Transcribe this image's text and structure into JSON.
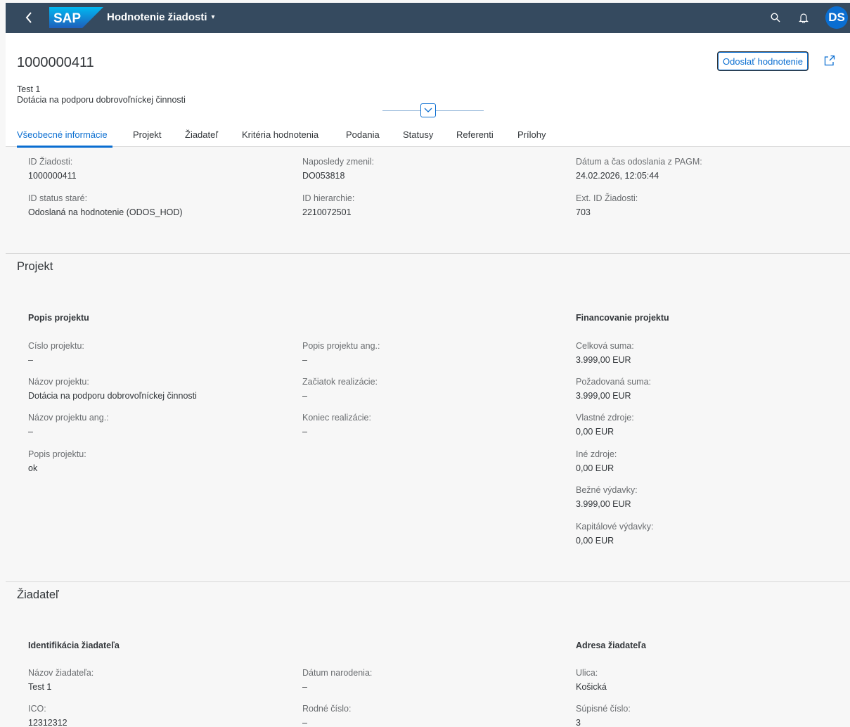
{
  "shell": {
    "title": "Hodnotenie žiadosti",
    "caret": "▾",
    "avatar": "DS",
    "icons": [
      "back-icon",
      "search-icon",
      "bell-icon"
    ]
  },
  "header": {
    "object_id": "1000000411",
    "subtitle1": "Test 1",
    "subtitle2": "Dotácia na podporu dobrovoľníckej činnosti",
    "send_button": "Odoslať hodnotenie"
  },
  "tabs": [
    "Všeobecné informácie",
    "Projekt",
    "Žiadateľ",
    "Kritéria hodnotenia",
    "Podania",
    "Statusy",
    "Referenti",
    "Prílohy"
  ],
  "general": {
    "f1": {
      "label": "ID Žiadosti:",
      "value": "1000000411"
    },
    "f2": {
      "label": "Naposledy zmenil:",
      "value": "DO053818"
    },
    "f3": {
      "label": "Dátum a čas odoslania z PAGM:",
      "value": "24.02.2026, 12:05:44"
    },
    "f4": {
      "label": "ID status staré:",
      "value": "Odoslaná na hodnotenie (ODOS_HOD)"
    },
    "f5": {
      "label": "ID hierarchie:",
      "value": "2210072501"
    },
    "f6": {
      "label": "Ext. ID Žiadosti:",
      "value": "703"
    }
  },
  "projekt": {
    "title": "Projekt",
    "group1": "Popis projektu",
    "group2": "Financovanie projektu",
    "c1": [
      {
        "label": "Císlo projektu:",
        "value": "–"
      },
      {
        "label": "Názov projektu:",
        "value": "Dotácia na podporu dobrovoľníckej činnosti"
      },
      {
        "label": "Názov projektu ang.:",
        "value": "–"
      },
      {
        "label": "Popis projektu:",
        "value": "ok"
      }
    ],
    "c2": [
      {
        "label": "Popis projektu ang.:",
        "value": "–"
      },
      {
        "label": "Začiatok realizácie:",
        "value": "–"
      },
      {
        "label": "Koniec realizácie:",
        "value": "–"
      }
    ],
    "c3": [
      {
        "label": "Celková suma:",
        "value": "3.999,00  EUR"
      },
      {
        "label": "Požadovaná suma:",
        "value": "3.999,00  EUR"
      },
      {
        "label": "Vlastné zdroje:",
        "value": "0,00  EUR"
      },
      {
        "label": "Iné zdroje:",
        "value": "0,00  EUR"
      },
      {
        "label": "Bežné výdavky:",
        "value": "3.999,00  EUR"
      },
      {
        "label": "Kapitálové výdavky:",
        "value": "0,00  EUR"
      }
    ]
  },
  "ziadatel": {
    "title": "Žiadateľ",
    "group1": "Identifikácia žiadateľa",
    "group2": "Adresa žiadateľa",
    "c1": [
      {
        "label": "Názov žiadateľa:",
        "value": "Test 1"
      },
      {
        "label": "ICO:",
        "value": "12312312"
      }
    ],
    "c2": [
      {
        "label": "Dátum narodenia:",
        "value": "–"
      },
      {
        "label": "Rodné číslo:",
        "value": "–"
      }
    ],
    "c3": [
      {
        "label": "Ulica:",
        "value": "Košická"
      },
      {
        "label": "Súpisné číslo:",
        "value": "3"
      }
    ]
  }
}
